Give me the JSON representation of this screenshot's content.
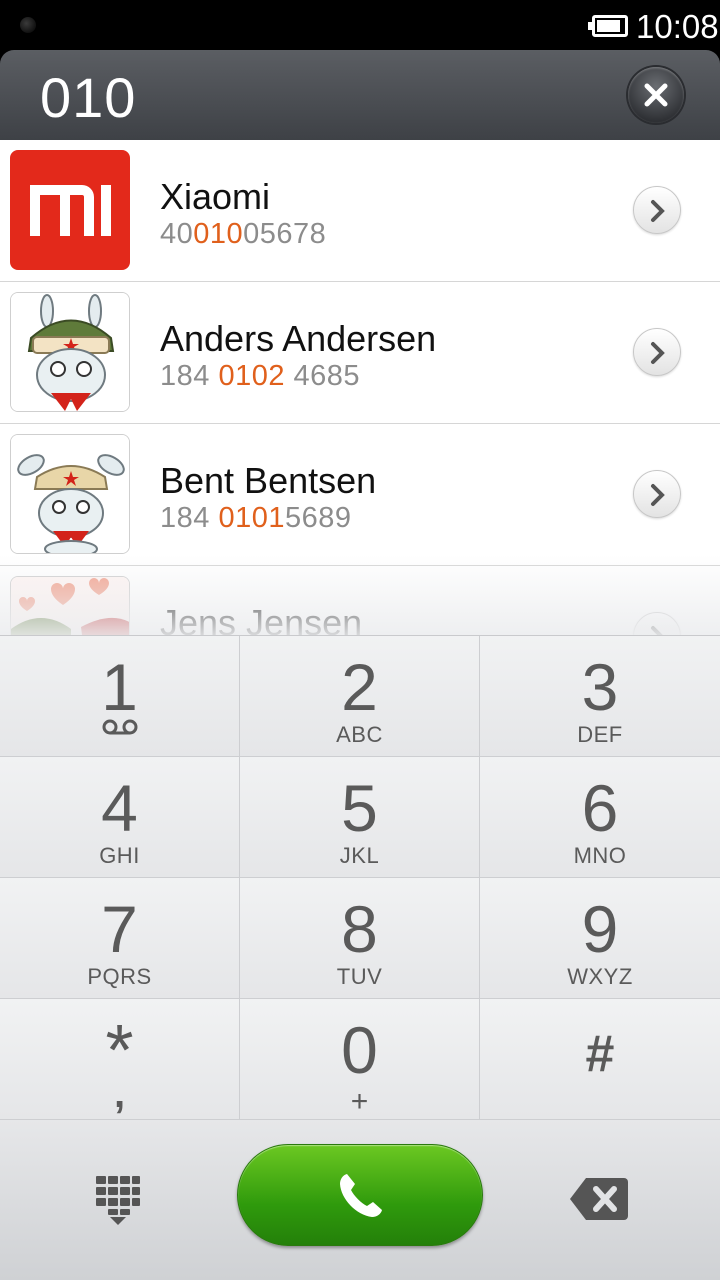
{
  "status_bar": {
    "time": "10:08",
    "battery_level": 0.9
  },
  "header": {
    "dialed_number": "010"
  },
  "contacts": [
    {
      "name": "Xiaomi",
      "number_parts": [
        "40",
        "010",
        "05678"
      ],
      "avatar": "mi-logo"
    },
    {
      "name": "Anders Andersen",
      "number_parts": [
        "184 ",
        "0102",
        " 4685"
      ],
      "avatar": "mitu-bunny"
    },
    {
      "name": "Bent Bentsen",
      "number_parts": [
        "184 ",
        "0101",
        "5689"
      ],
      "avatar": "mitu-bunny-waving"
    },
    {
      "name": "Jens Jensen",
      "number_parts": [
        "",
        "",
        ""
      ],
      "avatar": "mitu-bunny-hearts"
    }
  ],
  "keypad": [
    {
      "digit": "1",
      "letters": "",
      "icon": "voicemail-icon"
    },
    {
      "digit": "2",
      "letters": "ABC"
    },
    {
      "digit": "3",
      "letters": "DEF"
    },
    {
      "digit": "4",
      "letters": "GHI"
    },
    {
      "digit": "5",
      "letters": "JKL"
    },
    {
      "digit": "6",
      "letters": "MNO"
    },
    {
      "digit": "7",
      "letters": "PQRS"
    },
    {
      "digit": "8",
      "letters": "TUV"
    },
    {
      "digit": "9",
      "letters": "WXYZ"
    },
    {
      "digit": "*",
      "letters": ","
    },
    {
      "digit": "0",
      "letters": "+"
    },
    {
      "digit": "#",
      "letters": ""
    }
  ],
  "bottom_bar": {
    "left_icon": "dialpad-toggle-icon",
    "center_icon": "phone-icon",
    "right_icon": "backspace-icon"
  },
  "colors": {
    "highlight": "#e0601c",
    "call_green": "#3aa812",
    "mi_red": "#e3291b"
  }
}
